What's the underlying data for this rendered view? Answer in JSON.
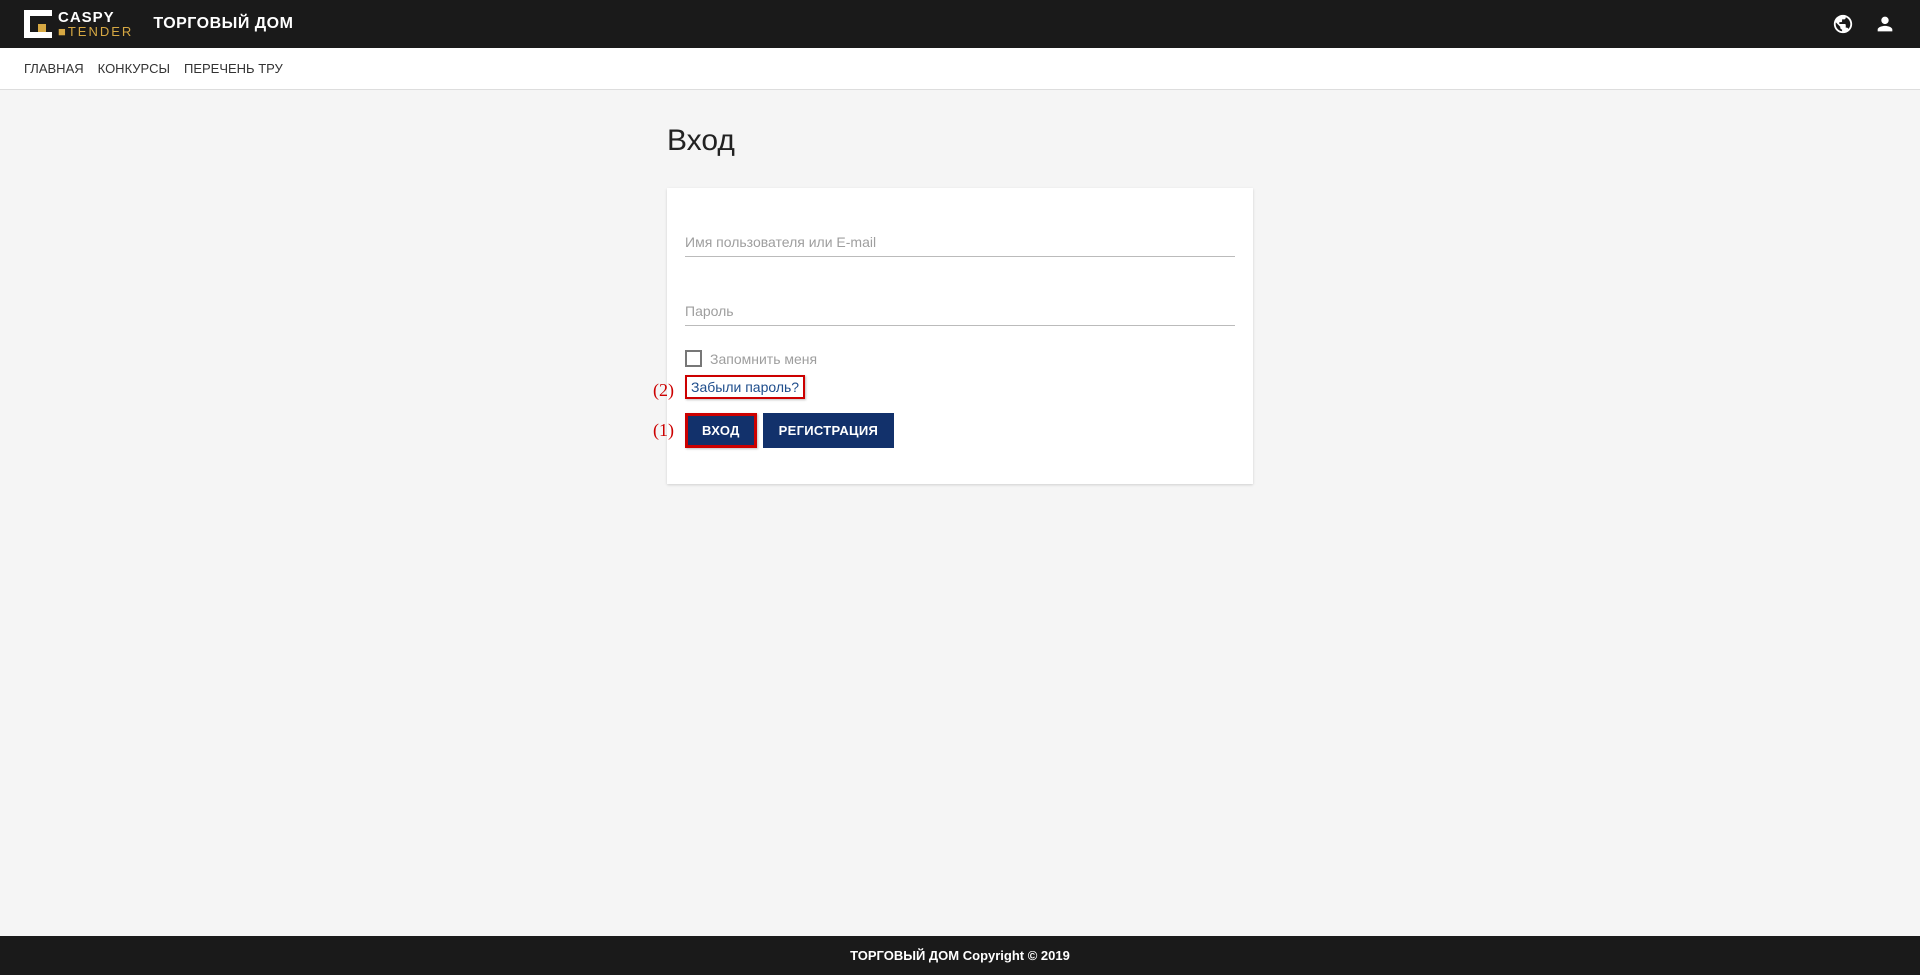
{
  "logo": {
    "top": "CASPY",
    "bottom_prefix": "■",
    "bottom": "TENDER"
  },
  "site_title": "ТОРГОВЫЙ ДОМ",
  "nav": {
    "items": [
      {
        "label": "ГЛАВНАЯ"
      },
      {
        "label": "КОНКУРСЫ"
      },
      {
        "label": "ПЕРЕЧЕНЬ ТРУ"
      }
    ]
  },
  "login": {
    "title": "Вход",
    "username_placeholder": "Имя пользователя или E-mail",
    "password_placeholder": "Пароль",
    "remember": "Запомнить меня",
    "forgot": "Забыли пароль?",
    "login_button": "ВХОД",
    "register_button": "РЕГИСТРАЦИЯ"
  },
  "annotations": {
    "a1": "(1)",
    "a2": "(2)"
  },
  "footer": "ТОРГОВЫЙ ДОМ Copyright © 2019"
}
